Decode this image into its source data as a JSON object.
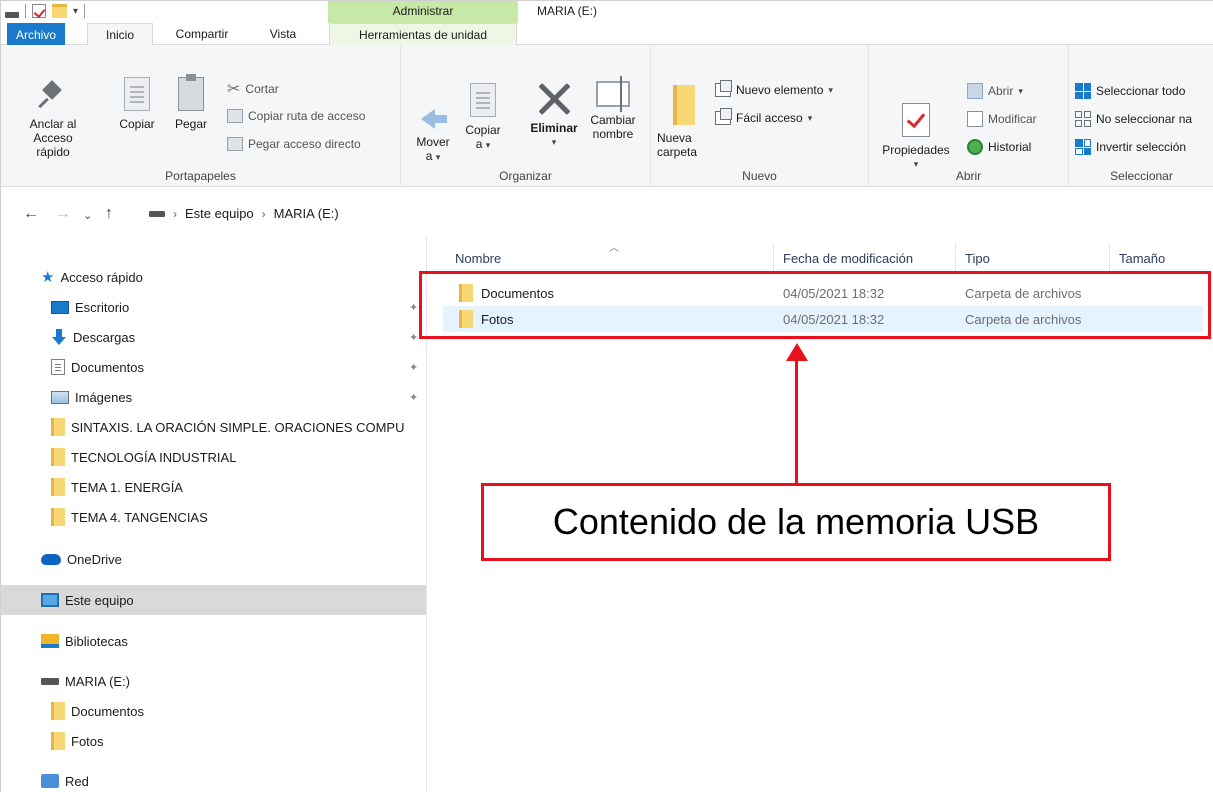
{
  "titlebar": {
    "context_tab": "Administrar",
    "window_title": "MARIA (E:)"
  },
  "tabs": {
    "archivo": "Archivo",
    "inicio": "Inicio",
    "compartir": "Compartir",
    "vista": "Vista",
    "herramientas": "Herramientas de unidad"
  },
  "ribbon": {
    "portapapeles": {
      "label": "Portapapeles",
      "anclar_line1": "Anclar al",
      "anclar_line2": "Acceso rápido",
      "copiar": "Copiar",
      "pegar": "Pegar",
      "cortar": "Cortar",
      "copiar_ruta": "Copiar ruta de acceso",
      "pegar_acceso": "Pegar acceso directo"
    },
    "organizar": {
      "label": "Organizar",
      "mover_line1": "Mover",
      "mover_line2": "a",
      "copiar_line1": "Copiar",
      "copiar_line2": "a",
      "eliminar": "Eliminar",
      "cambiar_line1": "Cambiar",
      "cambiar_line2": "nombre"
    },
    "nuevo": {
      "label": "Nuevo",
      "nueva_line1": "Nueva",
      "nueva_line2": "carpeta",
      "nuevo_elemento": "Nuevo elemento",
      "facil_acceso": "Fácil acceso"
    },
    "abrir": {
      "label": "Abrir",
      "propiedades": "Propiedades",
      "abrir": "Abrir",
      "modificar": "Modificar",
      "historial": "Historial"
    },
    "seleccionar": {
      "label": "Seleccionar",
      "todo": "Seleccionar todo",
      "ninguno": "No seleccionar na",
      "invertir": "Invertir selección"
    }
  },
  "address": {
    "crumbs": [
      "Este equipo",
      "MARIA (E:)"
    ]
  },
  "navpane": {
    "acceso_rapido": "Acceso rápido",
    "quick": [
      "Escritorio",
      "Descargas",
      "Documentos",
      "Imágenes"
    ],
    "folders": [
      "SINTAXIS. LA ORACIÓN SIMPLE. ORACIONES COMPU",
      "TECNOLOGÍA INDUSTRIAL",
      "TEMA 1. ENERGÍA",
      "TEMA 4. TANGENCIAS"
    ],
    "onedrive": "OneDrive",
    "este_equipo": "Este equipo",
    "bibliotecas": "Bibliotecas",
    "drive": "MARIA (E:)",
    "drive_children": [
      "Documentos",
      "Fotos"
    ],
    "red": "Red"
  },
  "columns": {
    "nombre": "Nombre",
    "fecha": "Fecha de modificación",
    "tipo": "Tipo",
    "tamano": "Tamaño"
  },
  "files": [
    {
      "name": "Documentos",
      "date": "04/05/2021 18:32",
      "type": "Carpeta de archivos"
    },
    {
      "name": "Fotos",
      "date": "04/05/2021 18:32",
      "type": "Carpeta de archivos"
    }
  ],
  "annotation": {
    "callout": "Contenido de la memoria USB",
    "color": "#e8111b"
  }
}
